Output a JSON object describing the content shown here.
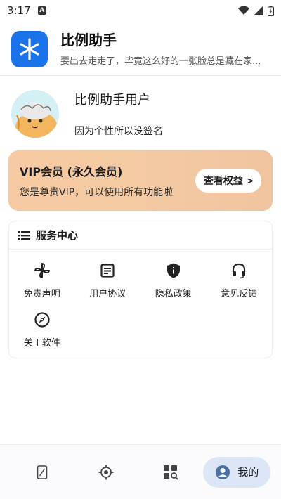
{
  "status_bar": {
    "time": "3:17",
    "notification_badge": "A"
  },
  "header": {
    "app_title": "比例助手",
    "app_subtitle": "要出去走走了，毕竟这么好的一张脸总是藏在家..."
  },
  "profile": {
    "username": "比例助手用户",
    "signature": "因为个性所以没签名"
  },
  "vip": {
    "title": "VIP会员 (永久会员)",
    "description": "您是尊贵VIP，可以使用所有功能啦",
    "button_label": "查看权益",
    "button_arrow": ">"
  },
  "services": {
    "title": "服务中心",
    "items": [
      {
        "label": "免责声明",
        "icon": "pinwheel-icon"
      },
      {
        "label": "用户协议",
        "icon": "document-icon"
      },
      {
        "label": "隐私政策",
        "icon": "privacy-shield-icon"
      },
      {
        "label": "意见反馈",
        "icon": "headset-icon"
      },
      {
        "label": "关于软件",
        "icon": "compass-icon"
      }
    ]
  },
  "bottom_nav": {
    "active_label": "我的"
  },
  "colors": {
    "brand_blue": "#1a73e8",
    "vip_gradient_start": "#f6cba3",
    "active_nav_bg": "#dde6f7"
  }
}
